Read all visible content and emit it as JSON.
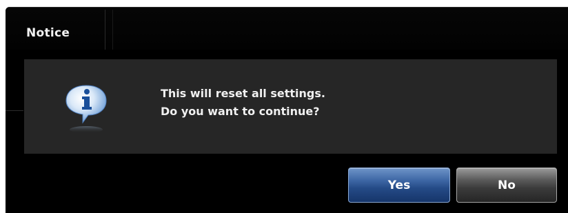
{
  "dialog": {
    "title": "Notice",
    "message_lines": [
      "This will reset all settings.",
      "Do you want to continue?"
    ],
    "icon": "info-icon",
    "buttons": {
      "yes_label": "Yes",
      "no_label": "No"
    }
  },
  "colors": {
    "dialog_background": "#000000",
    "panel_background": "#262626",
    "primary_button": "#2c5291",
    "secondary_button": "#3a3a3a",
    "text": "#f0f0f0"
  }
}
